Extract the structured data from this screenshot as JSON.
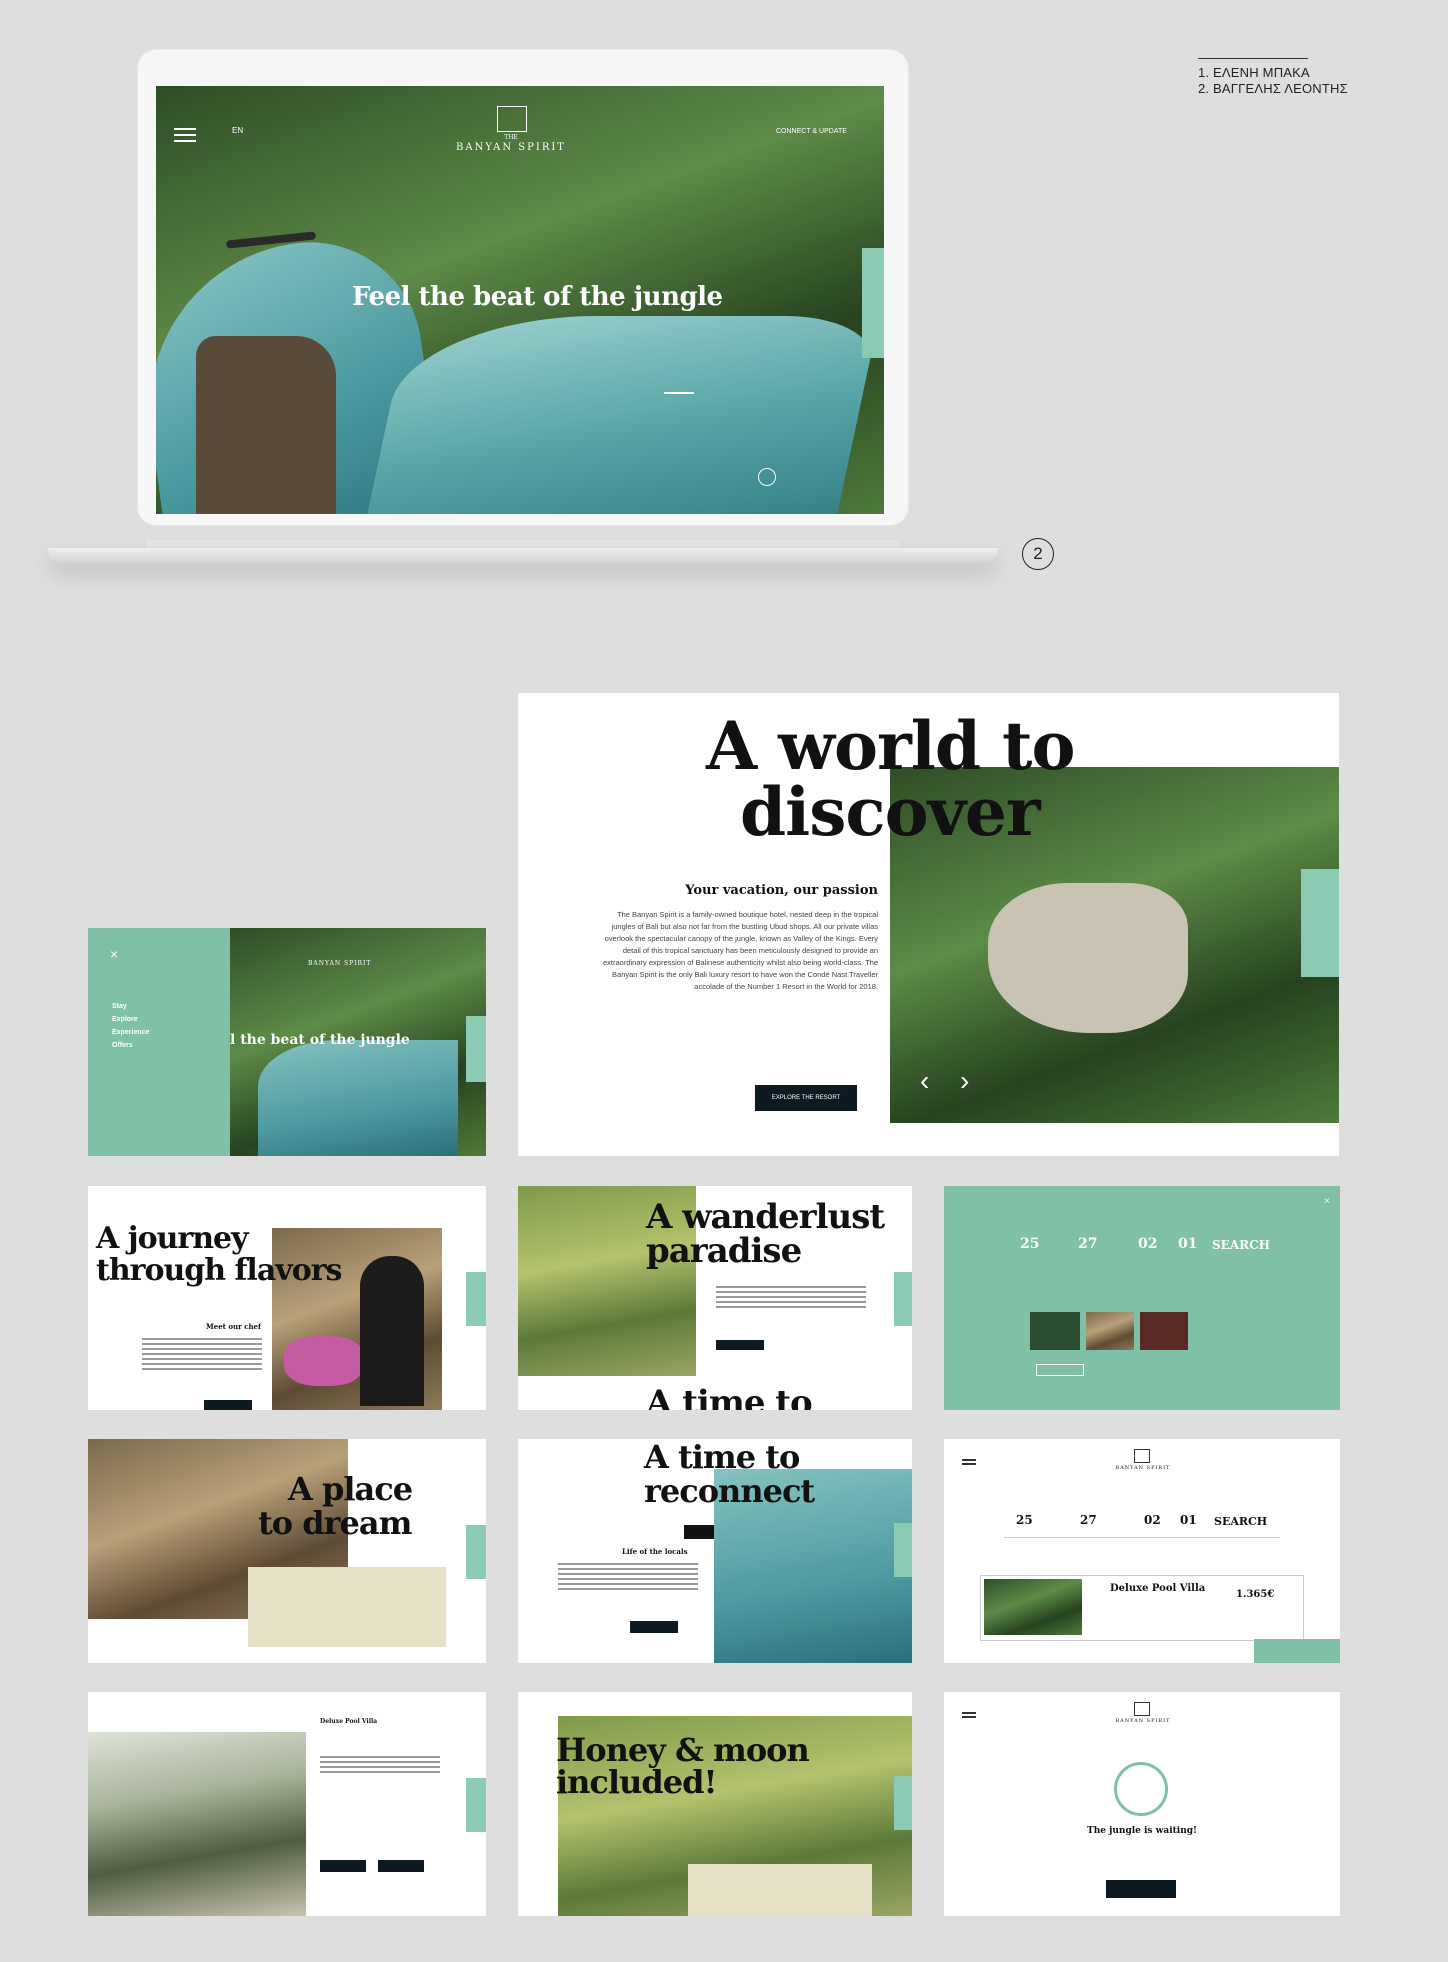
{
  "credits": {
    "line1": "1. ΕΛΕΝΗ ΜΠΑΚΑ",
    "line2": "2. ΒΑΓΓΕΛΗΣ ΛΕΟΝΤΗΣ"
  },
  "marker": "2",
  "laptop": {
    "logo_sub": "THE",
    "logo": "BANYAN SPIRIT",
    "lang": "EN",
    "top_right": "CONNECT & UPDATE",
    "headline": "Feel the beat of the jungle"
  },
  "discover": {
    "title_line1": "A world to",
    "title_line2": "discover",
    "subtitle": "Your vacation, our passion",
    "body": "The Banyan Spirit is a family-owned boutique hotel, nested deep in the tropical jungles of Bali but also not far from the bustling Ubud shops. All our private villas overlook the spectacular canopy of the jungle, known as Valley of the Kings. Every detail of this tropical sanctuary has been meticulously designed to provide an extraordinary expression of Balinese authenticity whilst also being world-class. The Banyan Spirit is the only Bali luxury resort to have won the Condé Nast Traveller accolade of the Number 1 Resort in the World for 2018.",
    "button": "EXPLORE THE RESORT",
    "prev": "‹",
    "next": "›"
  },
  "menu_slide": {
    "headline": "l the beat of the jungle",
    "logo": "BANYAN SPIRIT",
    "items": [
      "Stay",
      "Explore",
      "Experience",
      "Offers"
    ]
  },
  "journey": {
    "title_line1": "A journey",
    "title_line2": "through flavors",
    "subtitle": "Meet our chef"
  },
  "wanderlust": {
    "title_line1": "A wanderlust",
    "title_line2": "paradise",
    "peek": "A time to"
  },
  "booking_teal": {
    "d1": "25",
    "d2": "27",
    "n1": "02",
    "n2": "01",
    "search": "SEARCH"
  },
  "place": {
    "title_line1": "A place",
    "title_line2": "to dream"
  },
  "reconnect": {
    "title_line1": "A time to",
    "title_line2": "reconnect",
    "subtitle": "Life of the locals"
  },
  "results": {
    "logo": "BANYAN SPIRIT",
    "d1": "25",
    "d2": "27",
    "n1": "02",
    "n2": "01",
    "search": "SEARCH",
    "villa": "Deluxe Pool Villa",
    "price": "1.365€"
  },
  "villa": {
    "tab": "Deluxe Pool Villa"
  },
  "honey": {
    "title_line1": "Honey & moon",
    "title_line2": "included!"
  },
  "confirm": {
    "logo": "BANYAN SPIRIT",
    "message": "The jungle is waiting!"
  }
}
